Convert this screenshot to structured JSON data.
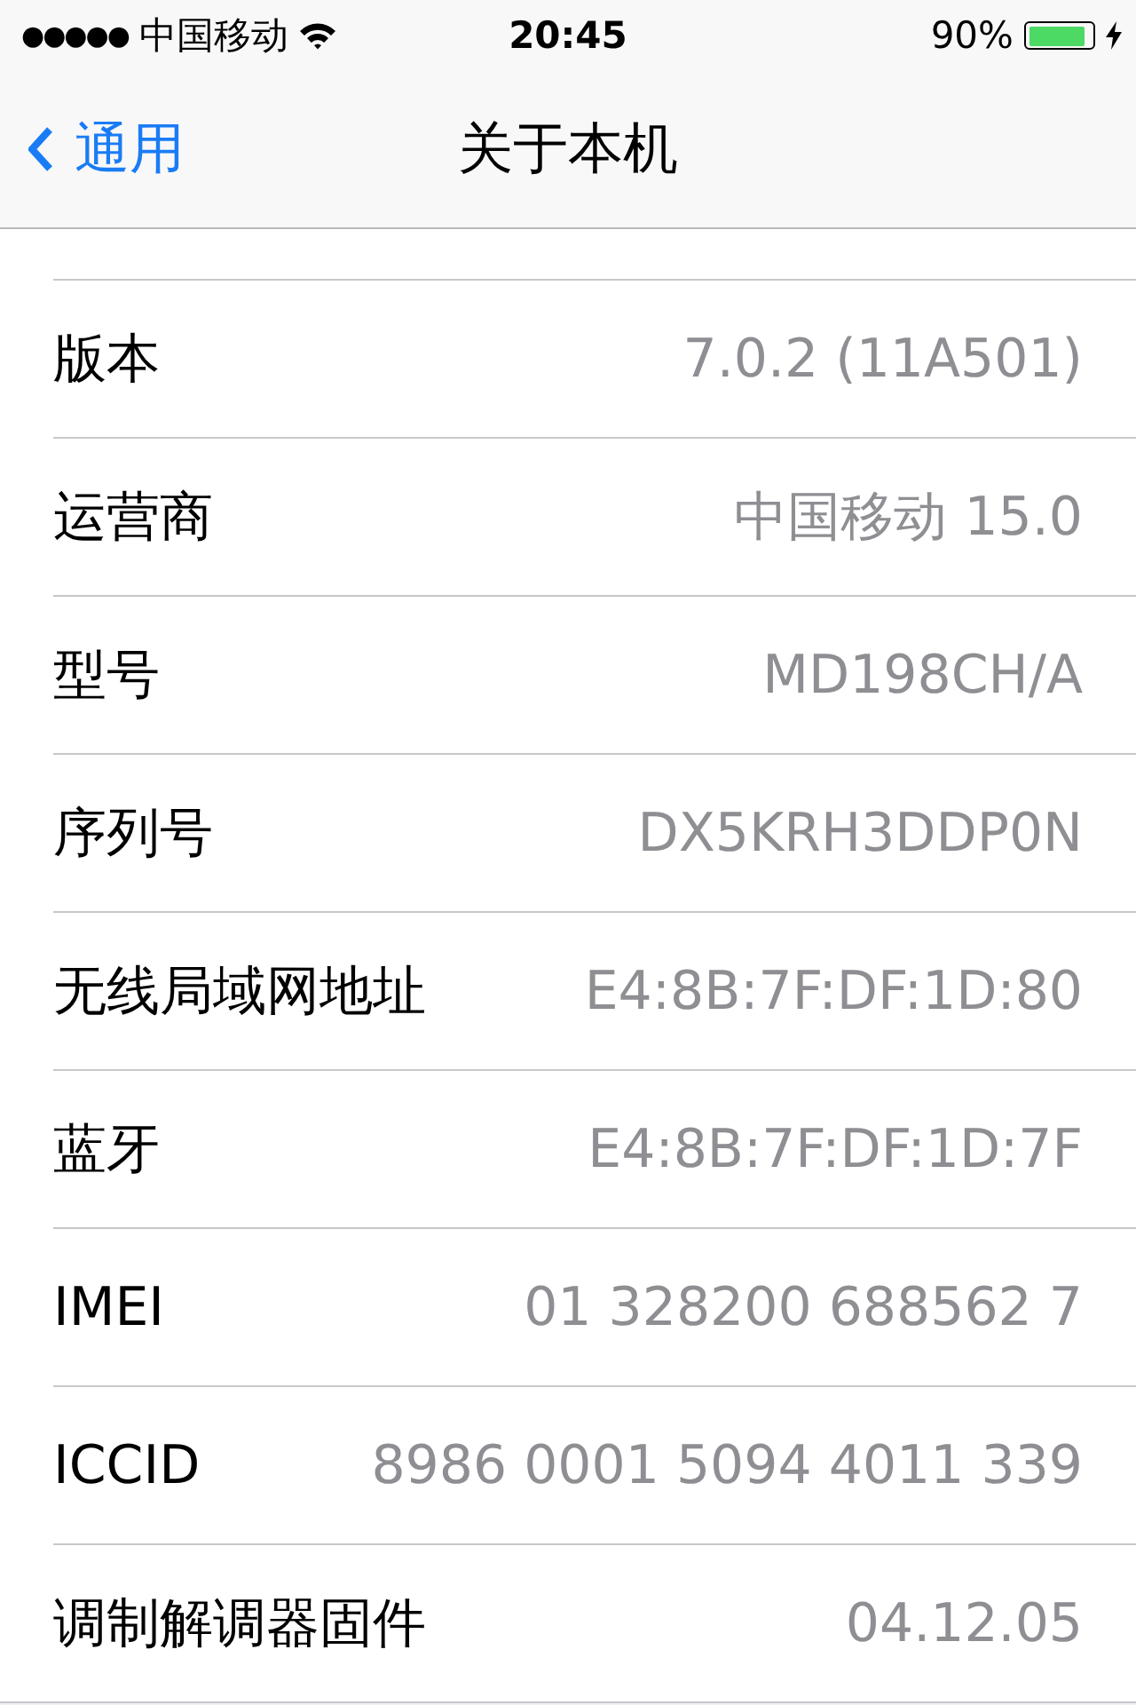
{
  "status_bar": {
    "signal": "●●●●●",
    "carrier": "中国移动",
    "time": "20:45",
    "battery_percent": "90%",
    "battery": {
      "level": 0.9
    }
  },
  "nav": {
    "back": "通用",
    "title": "关于本机"
  },
  "rows": [
    {
      "label": "版本",
      "value": "7.0.2 (11A501)"
    },
    {
      "label": "运营商",
      "value": "中国移动 15.0"
    },
    {
      "label": "型号",
      "value": "MD198CH/A"
    },
    {
      "label": "序列号",
      "value": "DX5KRH3DDP0N"
    },
    {
      "label": "无线局域网地址",
      "value": "E4:8B:7F:DF:1D:80"
    },
    {
      "label": "蓝牙",
      "value": "E4:8B:7F:DF:1D:7F"
    },
    {
      "label": "IMEI",
      "value": "01 328200 688562 7"
    },
    {
      "label": "ICCID",
      "value": "8986 0001 5094 4011 339"
    },
    {
      "label": "调制解调器固件",
      "value": "04.12.05"
    }
  ]
}
